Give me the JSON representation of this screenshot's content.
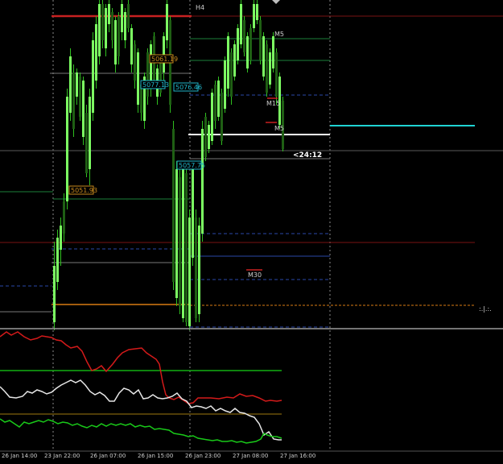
{
  "colors": {
    "background": "#000000",
    "candle_up": "#7cff62",
    "candle_down": "#1f5f14",
    "wick": "#2fbf1f",
    "level_red": "#c82121",
    "level_dark_red": "#7a1212",
    "level_green": "#1d7f3a",
    "level_gray": "#6a6a6a",
    "level_white": "#ffffff",
    "level_cyan": "#1fd3d3",
    "level_orange": "#d77a12",
    "level_blue": "#2a47a8",
    "tag_orange": "#c98a1d",
    "tag_cyan": "#1fb5c9",
    "indicator_red": "#d41a1a",
    "indicator_white": "#e6e6e6",
    "indicator_green": "#19c919",
    "indicator_level_green": "#13b013",
    "indicator_level_orange": "#a07a10"
  },
  "timeframe_labels": [
    {
      "name": "timeframe-label-h4",
      "text": "H4"
    },
    {
      "name": "timeframe-label-m5-top",
      "text": "M5"
    },
    {
      "name": "timeframe-label-m15",
      "text": "M15"
    },
    {
      "name": "timeframe-label-m5-bottom",
      "text": "M5"
    },
    {
      "name": "timeframe-label-m30",
      "text": "M30"
    }
  ],
  "price_tags": [
    {
      "name": "price-tag-5061-19",
      "text": "5061.19"
    },
    {
      "name": "price-tag-5077-13",
      "text": "5077.13"
    },
    {
      "name": "price-tag-5076-46",
      "text": "5076.46"
    },
    {
      "name": "price-tag-5057-75",
      "text": "5057.75"
    },
    {
      "name": "price-tag-5051-93",
      "text": "5051.93"
    }
  ],
  "countdown": "<24:12",
  "right_marker": ":.|.:.",
  "x_axis_labels": [
    "26 Jan 14:00",
    "23 Jan 22:00",
    "26 Jan 07:00",
    "26 Jan 15:00",
    "26 Jan 23:00",
    "27 Jan 08:00",
    "27 Jan 16:00"
  ]
}
